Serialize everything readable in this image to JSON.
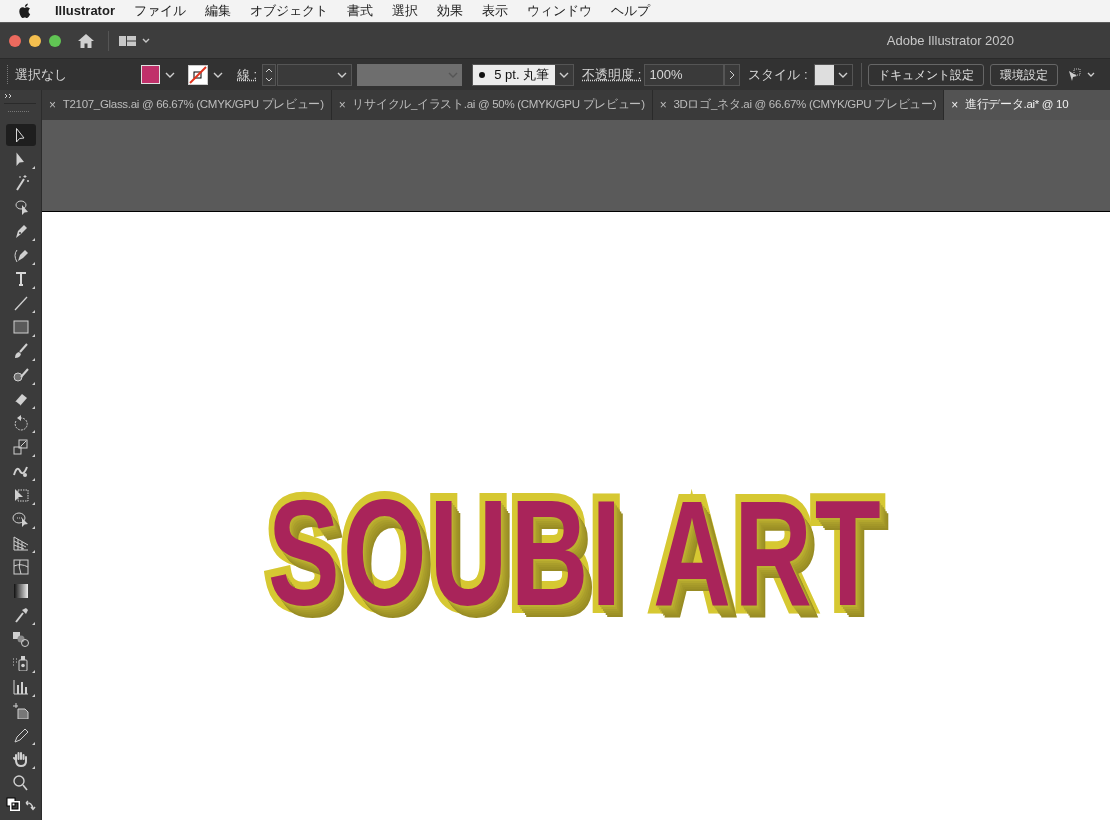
{
  "menu_bar": {
    "app_name": "Illustrator",
    "items": [
      "ファイル",
      "編集",
      "オブジェクト",
      "書式",
      "選択",
      "効果",
      "表示",
      "ウィンドウ",
      "ヘルプ"
    ]
  },
  "window": {
    "title": "Adobe Illustrator 2020"
  },
  "control_bar": {
    "selection": "選択なし",
    "stroke_label": "線 :",
    "brush": "5 pt. 丸筆",
    "opacity_label": "不透明度 :",
    "opacity": "100%",
    "style_label": "スタイル :",
    "buttons": [
      "ドキュメント設定",
      "環境設定"
    ]
  },
  "tabs": [
    {
      "close": "×",
      "label": "T2107_Glass.ai @ 66.67% (CMYK/GPU プレビュー)",
      "selected": false
    },
    {
      "close": "×",
      "label": "リサイクル_イラスト.ai @ 50% (CMYK/GPU プレビュー)",
      "selected": false
    },
    {
      "close": "×",
      "label": "3Dロゴ_ネタ.ai @ 66.67% (CMYK/GPU プレビュー)",
      "selected": false
    },
    {
      "close": "×",
      "label": "進行データ.ai* @ 10",
      "selected": true
    }
  ],
  "tools": [
    {
      "kind": "select",
      "flyout": false,
      "selected": true
    },
    {
      "kind": "direct",
      "flyout": true,
      "selected": false
    },
    {
      "kind": "wand",
      "flyout": false,
      "selected": false
    },
    {
      "kind": "lasso",
      "flyout": false,
      "selected": false
    },
    {
      "kind": "pen",
      "flyout": true,
      "selected": false
    },
    {
      "kind": "curvature",
      "flyout": true,
      "selected": false
    },
    {
      "kind": "type",
      "flyout": true,
      "selected": false
    },
    {
      "kind": "line",
      "flyout": true,
      "selected": false
    },
    {
      "kind": "rect",
      "flyout": true,
      "selected": false
    },
    {
      "kind": "brush",
      "flyout": true,
      "selected": false
    },
    {
      "kind": "shaper",
      "flyout": true,
      "selected": false
    },
    {
      "kind": "eraser",
      "flyout": true,
      "selected": false
    },
    {
      "kind": "rotate",
      "flyout": true,
      "selected": false
    },
    {
      "kind": "scale",
      "flyout": true,
      "selected": false
    },
    {
      "kind": "warp",
      "flyout": true,
      "selected": false
    },
    {
      "kind": "freetransform",
      "flyout": true,
      "selected": false
    },
    {
      "kind": "shapebuilder",
      "flyout": true,
      "selected": false
    },
    {
      "kind": "perspective",
      "flyout": true,
      "selected": false
    },
    {
      "kind": "mesh",
      "flyout": false,
      "selected": false
    },
    {
      "kind": "gradient",
      "flyout": false,
      "selected": false
    },
    {
      "kind": "eyedropper",
      "flyout": true,
      "selected": false
    },
    {
      "kind": "blend",
      "flyout": false,
      "selected": false
    },
    {
      "kind": "sprayer",
      "flyout": true,
      "selected": false
    },
    {
      "kind": "graph",
      "flyout": true,
      "selected": false
    },
    {
      "kind": "artboard",
      "flyout": false,
      "selected": false
    },
    {
      "kind": "slice",
      "flyout": true,
      "selected": false
    },
    {
      "kind": "hand",
      "flyout": true,
      "selected": false
    },
    {
      "kind": "zoom",
      "flyout": false,
      "selected": false
    }
  ],
  "artwork": {
    "text": "SOUBI ART"
  }
}
